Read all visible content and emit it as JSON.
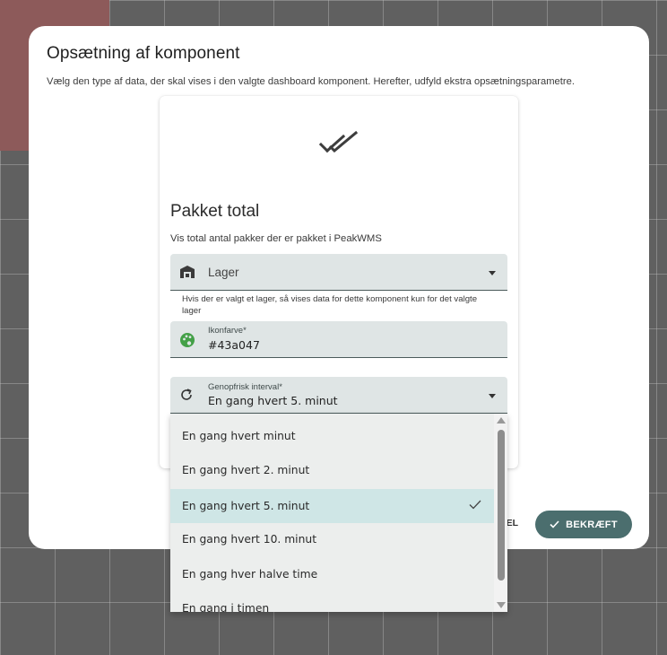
{
  "dialog": {
    "title": "Opsætning af komponent",
    "subtitle": "Vælg den type af data, der skal vises i den valgte dashboard komponent. Herefter, udfyld ekstra opsætningsparametre."
  },
  "card": {
    "icon": "double-check-icon",
    "title": "Pakket total",
    "description": "Vis total antal pakker der er pakket i PeakWMS"
  },
  "fields": {
    "lager": {
      "icon": "warehouse-icon",
      "placeholder": "Lager",
      "hint": "Hvis der er valgt et lager, så vises data for dette komponent kun for det valgte lager"
    },
    "icon_color": {
      "icon": "palette-icon",
      "label": "Ikonfarve*",
      "value": "#43a047"
    },
    "interval": {
      "icon": "refresh-icon",
      "label": "Genopfrisk interval*",
      "value": "En gang hvert 5. minut"
    }
  },
  "dropdown": {
    "options": [
      "En gang hvert minut",
      "En gang hvert 2. minut",
      "En gang hvert 5. minut",
      "En gang hvert 10. minut",
      "En gang hver halve time",
      "En gang i timen"
    ],
    "selected_index": 2
  },
  "actions": {
    "cancel_fragment": "EL",
    "confirm_label": "BEKRÆFT"
  },
  "colors": {
    "accent": "#4b6e6e",
    "field_bg": "#dfe5e5",
    "selected_bg": "#cfe6e6",
    "palette_icon": "#43a047"
  }
}
